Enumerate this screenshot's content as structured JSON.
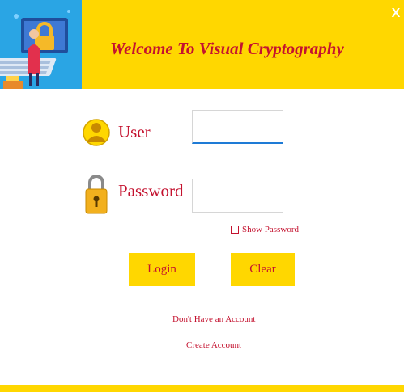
{
  "window": {
    "close_label": "X"
  },
  "header": {
    "title": "Welcome To Visual Cryptography"
  },
  "form": {
    "user_label": "User",
    "user_value": "",
    "password_label": "Password",
    "password_value": "",
    "show_password_label": "Show Password",
    "show_password_checked": false
  },
  "buttons": {
    "login": "Login",
    "clear": "Clear"
  },
  "links": {
    "no_account": "Don't Have an Account",
    "create_account": "Create Account"
  },
  "colors": {
    "accent": "#FFD700",
    "text": "#c4122f",
    "focus": "#1e7bd6",
    "illustration_bg": "#2aa5e4"
  },
  "icons": {
    "header": "security-illustration-icon",
    "user": "user-icon",
    "password": "padlock-icon"
  }
}
